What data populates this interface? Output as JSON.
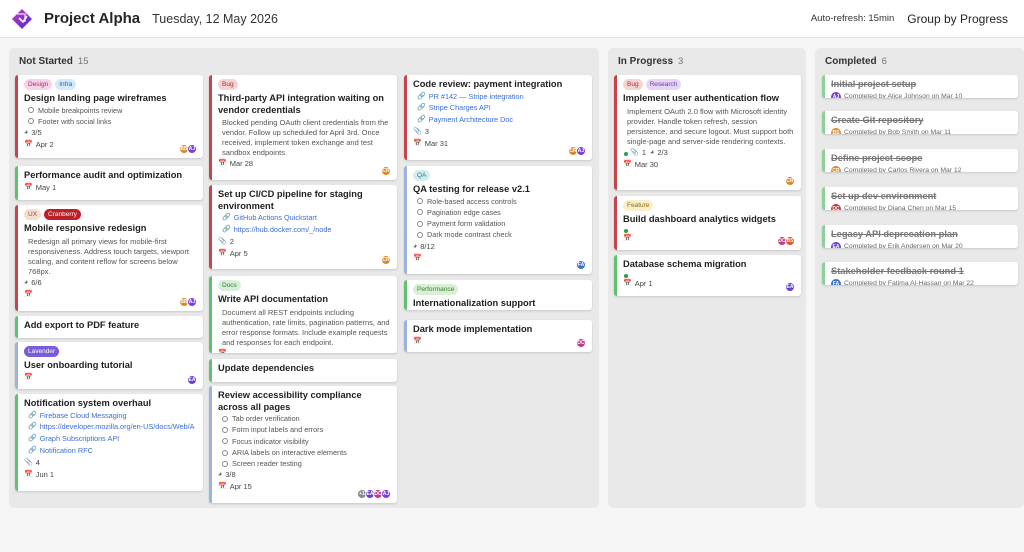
{
  "header": {
    "title": "Project Alpha",
    "date": "Tuesday, 12 May 2026",
    "refresh": "Auto-refresh: 15min",
    "group_by": "Group by Progress"
  },
  "colors": {
    "accent": "#7a40d8",
    "not_started": "#bd1f2a",
    "progress": "#c13b3b",
    "complete": "#8fcf9a"
  },
  "lanes": [
    {
      "name": "Not Started",
      "count": "15"
    },
    {
      "name": "In Progress",
      "count": "3"
    },
    {
      "name": "Completed",
      "count": "6"
    }
  ],
  "cards": [
    {
      "title": "Design landing page wireframes",
      "tags": [
        {
          "t": "Design",
          "bg": "#f6d4e8",
          "fg": "#a02a78"
        },
        {
          "t": "Infra",
          "bg": "#d6e8fb",
          "fg": "#285fa8"
        }
      ],
      "border": "#c9434b",
      "checks": [
        "Mobile breakpoints review",
        "Footer with social links"
      ],
      "progress": "3/5",
      "date": "Apr 2",
      "avatars": [
        {
          "i": "BB",
          "c": "#d98b2b"
        },
        {
          "i": "AJ",
          "c": "#7a40d8"
        }
      ]
    },
    {
      "title": "Performance audit and optimization",
      "border": "#5ec26e",
      "date": "May 1"
    },
    {
      "title": "Mobile responsive redesign",
      "tags": [
        {
          "t": "UX",
          "bg": "#f4dfd2",
          "fg": "#8d4a24"
        },
        {
          "t": "Cranberry",
          "bg": "#bd1f2a",
          "fg": "#fff"
        }
      ],
      "border": "#c9434b",
      "desc": "Redesign all primary views for mobile-first responsiveness. Address touch targets, viewport scaling, and content reflow for screens below 768px.",
      "progress": "6/6",
      "avatars": [
        {
          "i": "BB",
          "c": "#d98b2b"
        },
        {
          "i": "AJ",
          "c": "#7a40d8"
        }
      ]
    },
    {
      "title": "Add export to PDF feature",
      "border": "#5ec26e"
    },
    {
      "title": "User onboarding tutorial",
      "tags": [
        {
          "t": "Lavender",
          "bg": "#7a5bd8",
          "fg": "#fff"
        }
      ],
      "border": "#9bb3dd",
      "avatars": [
        {
          "i": "EA",
          "c": "#6a3fd0"
        }
      ]
    },
    {
      "title": "Notification system overhaul",
      "border": "#5ec26e",
      "links": [
        "Firebase Cloud Messaging",
        "https://developer.mozilla.org/en-US/docs/Web/A",
        "Graph Subscriptions API",
        "Notification RFC"
      ],
      "attach": "4",
      "date": "Jun 1"
    },
    {
      "title": "Third-party API integration waiting on vendor credentials",
      "tags": [
        {
          "t": "Bug",
          "bg": "#f6d3d3",
          "fg": "#a53232"
        }
      ],
      "border": "#c9434b",
      "desc": "Blocked pending OAuth client credentials from the vendor. Follow up scheduled for April 3rd. Once received, implement token exchange and test sandbox endpoints.",
      "date": "Mar 28",
      "avatars": [
        {
          "i": "CR",
          "c": "#d98b2b"
        }
      ]
    },
    {
      "title": "Set up CI/CD pipeline for staging environment",
      "border": "#c9434b",
      "links": [
        "GitHub Actions Quickstart",
        "https://hub.docker.com/_/node"
      ],
      "attach": "2",
      "date": "Apr 5",
      "avatars": [
        {
          "i": "CR",
          "c": "#d98b2b"
        }
      ]
    },
    {
      "title": "Write API documentation",
      "tags": [
        {
          "t": "Docs",
          "bg": "#d7efd9",
          "fg": "#2f7a3c"
        }
      ],
      "border": "#5ec26e",
      "desc": "Document all REST endpoints including authentication, rate limits, pagination patterns, and error response formats. Include example requests and responses for each endpoint."
    },
    {
      "title": "Update dependencies",
      "border": "#5ec26e"
    },
    {
      "title": "Review accessibility compliance across all pages",
      "border": "#9bb3dd",
      "checks": [
        "Tab order verification",
        "Form input labels and errors",
        "Focus indicator visibility",
        "ARIA labels on interactive elements",
        "Screen reader testing"
      ],
      "progress": "3/8",
      "date": "Apr 15",
      "avatars": [
        {
          "i": "+1",
          "c": "#8a8a8a"
        },
        {
          "i": "EA",
          "c": "#6a3fd0"
        },
        {
          "i": "DC",
          "c": "#c13b8f"
        },
        {
          "i": "AJ",
          "c": "#7a40d8"
        }
      ]
    },
    {
      "title": "Code review: payment integration",
      "border": "#c9434b",
      "links": [
        "PR #142 — Stripe integration",
        "Stripe Charges API",
        "Payment Architecture Doc"
      ],
      "attach": "3",
      "date": "Mar 31",
      "avatars": [
        {
          "i": "CR",
          "c": "#d98b2b"
        },
        {
          "i": "AJ",
          "c": "#7a40d8"
        }
      ]
    },
    {
      "title": "QA testing for release v2.1",
      "tags": [
        {
          "t": "QA",
          "bg": "#d2eef0",
          "fg": "#2b7b82"
        }
      ],
      "border": "#9bb3dd",
      "checks": [
        "Role-based access controls",
        "Pagination edge cases",
        "Payment form validation",
        "Dark mode contrast check"
      ],
      "progress": "8/12",
      "avatars": [
        {
          "i": "FA",
          "c": "#3b6fd0"
        }
      ]
    },
    {
      "title": "Internationalization support",
      "tags": [
        {
          "t": "Performance",
          "bg": "#d9f0d4",
          "fg": "#3a7a2e"
        }
      ],
      "border": "#5ec26e"
    },
    {
      "title": "Dark mode implementation",
      "border": "#9bb3dd",
      "avatars": [
        {
          "i": "DC",
          "c": "#c13b8f"
        }
      ]
    },
    {
      "title": "Implement user authentication flow",
      "tags": [
        {
          "t": "Bug",
          "bg": "#f6d3d3",
          "fg": "#a53232"
        },
        {
          "t": "Research",
          "bg": "#e5d6f5",
          "fg": "#6a3aa6"
        }
      ],
      "border": "#c9434b",
      "desc": "Implement OAuth 2.0 flow with Microsoft identity provider. Handle token refresh, session persistence, and secure logout. Must support both single-page and server-side rendering contexts.",
      "attach": "1",
      "progress": "2/3",
      "date": "Mar 30",
      "avatars": [
        {
          "i": "CR",
          "c": "#d98b2b"
        }
      ]
    },
    {
      "title": "Build dashboard analytics widgets",
      "tags": [
        {
          "t": "Feature",
          "bg": "#fbefc9",
          "fg": "#8a6a14"
        }
      ],
      "border": "#c9434b",
      "avatars": [
        {
          "i": "DC",
          "c": "#c13b8f"
        },
        {
          "i": "BS",
          "c": "#d9582b"
        }
      ]
    },
    {
      "title": "Database schema migration",
      "border": "#5ec26e",
      "date": "Apr 1",
      "avatars": [
        {
          "i": "EA",
          "c": "#6a3fd0"
        }
      ]
    },
    {
      "title": "Initial project setup",
      "by": "Completed by Alice Johnson on Mar 10",
      "av": {
        "i": "AJ",
        "c": "#7a40d8"
      }
    },
    {
      "title": "Create Git repository",
      "by": "Completed by Bob Smith on Mar 11",
      "av": {
        "i": "BS",
        "c": "#d98b2b"
      }
    },
    {
      "title": "Define project scope",
      "by": "Completed by Carlos Rivera on Mar 12",
      "av": {
        "i": "CR",
        "c": "#d98b2b"
      }
    },
    {
      "title": "Set up dev environment",
      "by": "Completed by Diana Chen on Mar 15",
      "av": {
        "i": "DC",
        "c": "#c13b3b"
      }
    },
    {
      "title": "Legacy API deprecation plan",
      "by": "Completed by Erik Andersen on Mar 20",
      "av": {
        "i": "EA",
        "c": "#6a3fd0"
      }
    },
    {
      "title": "Stakeholder feedback round 1",
      "by": "Completed by Fatima Al-Hassan on Mar 22",
      "av": {
        "i": "FA",
        "c": "#3b6fd0"
      }
    }
  ]
}
